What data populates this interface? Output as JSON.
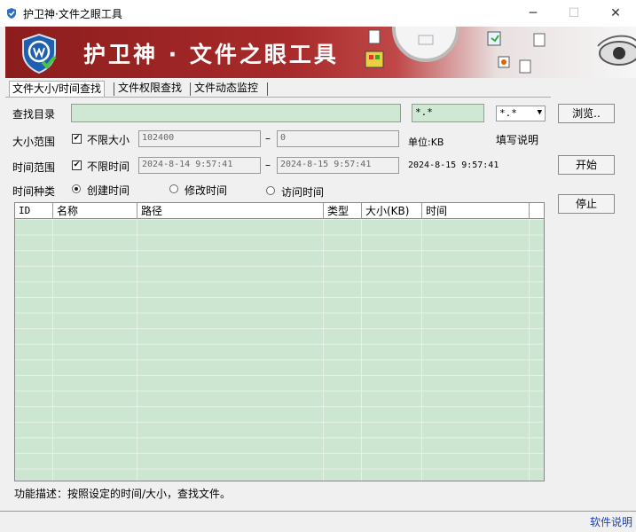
{
  "window": {
    "title": "护卫神·文件之眼工具",
    "minimize": "─",
    "maximize": "☐",
    "close": "✕"
  },
  "banner": {
    "title": "护卫神 · 文件之眼工具"
  },
  "tabs": [
    "文件大小/时间查找",
    "文件权限查找",
    "文件动态监控"
  ],
  "search_dir": {
    "label": "查找目录",
    "value": "",
    "pattern": "*.*",
    "ext_select": "*.*",
    "browse_label": "浏览.."
  },
  "size_range": {
    "label": "大小范围",
    "checkbox_label": "不限大小",
    "checked": true,
    "min": "102400",
    "dash": "–",
    "max": "0",
    "unit": "单位:KB",
    "help": "填写说明"
  },
  "time_range": {
    "label": "时间范围",
    "checkbox_label": "不限时间",
    "checked": true,
    "start": "2024-8-14  9:57:41",
    "dash": "–",
    "end": "2024-8-15  9:57:41",
    "current": "2024-8-15  9:57:41",
    "start_label": "开始"
  },
  "time_type": {
    "label": "时间种类",
    "options": [
      "创建时间",
      "修改时间",
      "访问时间"
    ],
    "selected": 0
  },
  "stop_label": "停止",
  "table": {
    "columns": [
      "ID",
      "名称",
      "路径",
      "类型",
      "大小(KB)",
      "时间"
    ],
    "rows": []
  },
  "status": "功能描述：按照设定的时间/大小，查找文件。",
  "help_link": "软件说明",
  "colors": {
    "banner_red": "#a82a2a",
    "field_green": "#cfe8d4",
    "link_blue": "#1a3fbf"
  }
}
